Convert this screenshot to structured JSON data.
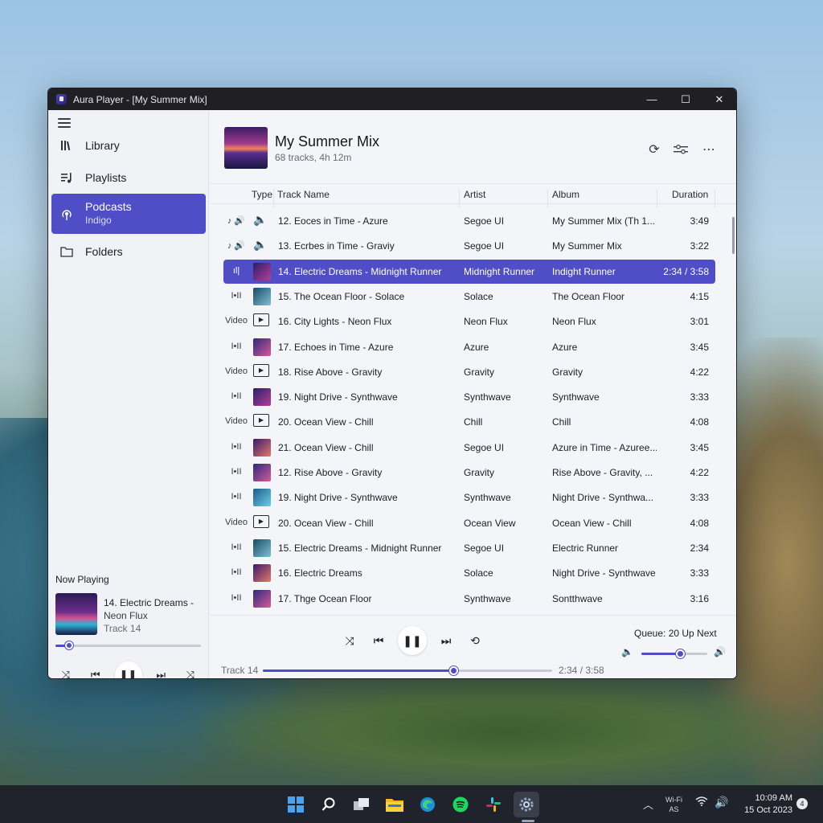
{
  "window": {
    "title": "Aura Player - [My Summer Mix]",
    "controls": {
      "minimize": "—",
      "maximize": "☐",
      "close": "✕"
    }
  },
  "sidebar": {
    "items": [
      {
        "label": "Library",
        "icon": "library-icon"
      },
      {
        "label": "Playlists",
        "icon": "playlists-icon"
      },
      {
        "label": "Podcasts",
        "sublabel": "Indigo",
        "icon": "podcast-icon",
        "active": true
      },
      {
        "label": "Folders",
        "icon": "folder-icon"
      }
    ],
    "now_playing": {
      "heading": "Now Playing",
      "line1": "14. Electric Dreams -",
      "line2": "Neon Flux",
      "line3": "Track 14",
      "progress": 0.1
    }
  },
  "playlist": {
    "title": "My Summer Mix",
    "subtitle": "68 tracks, 4h 12m"
  },
  "columns": {
    "type": "Type",
    "name": "Track Name",
    "artist": "Artist",
    "album": "Album",
    "duration": "Duration"
  },
  "tracks": [
    {
      "type": "♪ 🔊",
      "name": "12. Eoces in Time - Azure",
      "artist": "Segoe UI",
      "album": "My Summer Mix (Th 1...",
      "duration": "3:49"
    },
    {
      "type": "♪ 🔊",
      "name": "13. Ecrbes in Time - Graviy",
      "artist": "Segoe UI",
      "album": "My Summer Mix",
      "duration": "3:22"
    },
    {
      "type": "ıl|",
      "name": "14. Electric Dreams - Midnight Runner",
      "artist": "Midnight Runner",
      "album": "Indight Runner",
      "duration": "2:34 / 3:58",
      "selected": true
    },
    {
      "type": "I•II",
      "name": "15. The Ocean Floor - Solace",
      "artist": "Solace",
      "album": "The Ocean Floor",
      "duration": "4:15"
    },
    {
      "type": "Video",
      "name": "16. City Lights - Neon Flux",
      "artist": "Neon Flux",
      "album": "Neon Flux",
      "duration": "3:01"
    },
    {
      "type": "I•II",
      "name": "17. Echoes in Time - Azure",
      "artist": "Azure",
      "album": "Azure",
      "duration": "3:45"
    },
    {
      "type": "Video",
      "name": "18. Rise Above - Gravity",
      "artist": "Gravity",
      "album": "Gravity",
      "duration": "4:22"
    },
    {
      "type": "I•II",
      "name": "19. Night Drive - Synthwave",
      "artist": "Synthwave",
      "album": "Synthwave",
      "duration": "3:33"
    },
    {
      "type": "Video",
      "name": "20. Ocean View - Chill",
      "artist": "Chill",
      "album": "Chill",
      "duration": "4:08"
    },
    {
      "type": "I•II",
      "name": "21. Ocean View - Chill",
      "artist": "Segoe UI",
      "album": "Azure in Time - Azuree...",
      "duration": "3:45"
    },
    {
      "type": "I•II",
      "name": "12. Rise Above - Gravity",
      "artist": "Gravity",
      "album": "Rise Above - Gravity, ...",
      "duration": "4:22"
    },
    {
      "type": "I•II",
      "name": "19. Night Drive - Synthwave",
      "artist": "Synthwave",
      "album": "Night Drive - Synthwa...",
      "duration": "3:33"
    },
    {
      "type": "Video",
      "name": "20. Ocean View - Chill",
      "artist": "Ocean View",
      "album": "Ocean View - Chill",
      "duration": "4:08"
    },
    {
      "type": "I•II",
      "name": "15. Electric Dreams - Midnight Runner",
      "artist": "Segoe UI",
      "album": "Electric Runner",
      "duration": "2:34"
    },
    {
      "type": "I•II",
      "name": "16. Electric Dreams",
      "artist": "Solace",
      "album": "Night Drive - Synthwave",
      "duration": "3:33"
    },
    {
      "type": "I•II",
      "name": "17. Thge Ocean Floor",
      "artist": "Synthwave",
      "album": "Sontthwave",
      "duration": "3:16"
    }
  ],
  "player": {
    "track_label": "Track 14",
    "time": "2:34 / 3:58",
    "progress": 0.66,
    "queue": "Queue: 20 Up Next",
    "volume": 0.6
  },
  "taskbar": {
    "wifi_label": "Wi-Fi\nAS",
    "time": "10:09 AM",
    "date": "15 Oct 2023",
    "notifications": "4"
  },
  "colors": {
    "accent": "#4f4ec6",
    "titlebar": "#1f1f24",
    "taskbar": "#20232b"
  }
}
